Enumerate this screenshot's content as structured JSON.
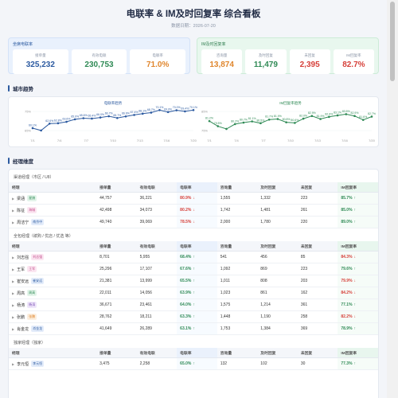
{
  "header": {
    "title": "电联率 & IM及时回复率 综合看板",
    "subtitle": "数据日期：2026-07-20"
  },
  "summary": {
    "call": {
      "title": "坐席电联率",
      "cards": [
        {
          "label": "接单量",
          "value": "325,232",
          "color": "#2c5aa0"
        },
        {
          "label": "有效电联",
          "value": "230,753",
          "color": "#2f8a55"
        },
        {
          "label": "电联率",
          "value": "71.0%",
          "color": "#e0862d"
        }
      ]
    },
    "im": {
      "title": "IM及时回复率",
      "cards": [
        {
          "label": "咨询量",
          "value": "13,874",
          "color": "#e0862d"
        },
        {
          "label": "及时回复",
          "value": "11,479",
          "color": "#2f8a55"
        },
        {
          "label": "未回复",
          "value": "2,395",
          "color": "#d6403a"
        },
        {
          "label": "IM回复率",
          "value": "82.7%",
          "color": "#d6403a"
        }
      ]
    }
  },
  "trend": {
    "section_title": "城市趋势",
    "call_chart": {
      "title": "电联率趋势",
      "color": "#2c5aa0",
      "y_labels": [
        "75%",
        "65%"
      ],
      "x_labels": [
        "7/1",
        "7/4",
        "7/7",
        "7/10",
        "7/13",
        "7/16",
        "7/20"
      ],
      "values": [
        60.1,
        58.8,
        62.6,
        62.8,
        63.6,
        65.0,
        65.6,
        65.4,
        66.0,
        66.7,
        65.7,
        66.6,
        67.4,
        68.1,
        68.7,
        70.1,
        69.0,
        70.0,
        69.4,
        70.1
      ],
      "point_labels": [
        "60.1%",
        "",
        "62.6%",
        "62.8%",
        "63.6%",
        "65.0%",
        "65.6%",
        "65.4%",
        "66.0%",
        "66.7%",
        "65.7%",
        "66.6%",
        "67.4%",
        "68.1%",
        "68.7%",
        "70.1%",
        "69.0%",
        "70.0%",
        "69.4%",
        "70.1%"
      ]
    },
    "im_chart": {
      "title": "IM回复率趋势",
      "color": "#2f8a55",
      "y_labels": [
        "85%",
        "75%"
      ],
      "x_labels": [
        "7/1",
        "7/4",
        "7/7",
        "7/10",
        "7/13",
        "7/16",
        "7/20"
      ],
      "values": [
        81.2,
        79.5,
        78.6,
        80.2,
        80.7,
        81.1,
        80.5,
        81.7,
        81.9,
        80.8,
        80.6,
        82.0,
        82.9,
        81.9,
        82.6,
        83.1,
        83.5,
        82.9,
        81.6,
        82.7
      ],
      "point_labels": [
        "81.2%",
        "79.5%",
        "",
        "80.2%",
        "80.7%",
        "81.1%",
        "80.5%",
        "81.7%",
        "81.9%",
        "80.8%",
        "80.6%",
        "82.0%",
        "82.9%",
        "81.9%",
        "82.6%",
        "83.1%",
        "83.5%",
        "82.9%",
        "81.6%",
        "82.7%"
      ]
    }
  },
  "detail": {
    "section_title": "经理维度",
    "columns": [
      "经理",
      "接单量",
      "有效电联",
      "电联率",
      "咨询量",
      "及时回复",
      "未回复",
      "IM回复率"
    ],
    "groups": [
      {
        "title": "渠道经理（市区 / U8）",
        "rows": [
          {
            "name": "梁涵",
            "tag": "星旗",
            "tag_color": "#2f8a55",
            "tag_bg": "#e3f4ea",
            "v1": "44,757",
            "v2": "36,221",
            "rate": "80.9%",
            "rate_arrow": "↓",
            "v3": "1,555",
            "v4": "1,332",
            "v5": "223",
            "im": "85.7%",
            "im_arrow": "↑"
          },
          {
            "name": "陈征",
            "tag": "海城",
            "tag_color": "#c24b8a",
            "tag_bg": "#fbe6f1",
            "v1": "42,498",
            "v2": "34,073",
            "rate": "80.2%",
            "rate_arrow": "↓",
            "v3": "1,742",
            "v4": "1,481",
            "v5": "261",
            "im": "85.0%",
            "im_arrow": "↑"
          },
          {
            "name": "周洁宁",
            "tag": "南京中",
            "tag_color": "#2c5aa0",
            "tag_bg": "#e3ecfa",
            "v1": "49,740",
            "v2": "39,069",
            "rate": "78.5%",
            "rate_arrow": "↓",
            "v3": "2,000",
            "v4": "1,780",
            "v5": "220",
            "im": "89.0%",
            "im_arrow": "↑"
          }
        ]
      },
      {
        "title": "全包经理（缤购 / 优店 / 优选 等）",
        "rows": [
          {
            "name": "刘志强",
            "tag": "刘志强",
            "tag_color": "#c24b8a",
            "tag_bg": "#fbe6f1",
            "v1": "8,701",
            "v2": "5,955",
            "rate": "68.4%",
            "rate_arrow": "↑",
            "v3": "541",
            "v4": "456",
            "v5": "85",
            "im": "84.3%",
            "im_arrow": "↓"
          },
          {
            "name": "王军",
            "tag": "王军",
            "tag_color": "#c24b8a",
            "tag_bg": "#fbe6f1",
            "v1": "25,296",
            "v2": "17,107",
            "rate": "67.6%",
            "rate_arrow": "↑",
            "v3": "1,092",
            "v4": "869",
            "v5": "223",
            "im": "79.6%",
            "im_arrow": "↑"
          },
          {
            "name": "崔安远",
            "tag": "崔安远",
            "tag_color": "#2c5aa0",
            "tag_bg": "#e3ecfa",
            "v1": "21,381",
            "v2": "13,999",
            "rate": "65.5%",
            "rate_arrow": "↑",
            "v3": "1,011",
            "v4": "808",
            "v5": "203",
            "im": "79.9%",
            "im_arrow": "↓"
          },
          {
            "name": "周高",
            "tag": "周高",
            "tag_color": "#2f8a55",
            "tag_bg": "#e3f4ea",
            "v1": "22,011",
            "v2": "14,056",
            "rate": "63.9%",
            "rate_arrow": "↑",
            "v3": "1,023",
            "v4": "861",
            "v5": "162",
            "im": "84.2%",
            "im_arrow": "↓"
          },
          {
            "name": "杨涛",
            "tag": "杨涛",
            "tag_color": "#7a4fb3",
            "tag_bg": "#efe6fa",
            "v1": "36,671",
            "v2": "23,461",
            "rate": "64.0%",
            "rate_arrow": "↑",
            "v3": "1,575",
            "v4": "1,214",
            "v5": "361",
            "im": "77.1%",
            "im_arrow": "↑"
          },
          {
            "name": "张鹏",
            "tag": "张鹏",
            "tag_color": "#e0862d",
            "tag_bg": "#fcefe0",
            "v1": "28,762",
            "v2": "18,211",
            "rate": "63.3%",
            "rate_arrow": "↑",
            "v3": "1,448",
            "v4": "1,190",
            "v5": "258",
            "im": "82.2%",
            "im_arrow": "↓"
          },
          {
            "name": "肖金龙",
            "tag": "肖金龙",
            "tag_color": "#2c5aa0",
            "tag_bg": "#e3ecfa",
            "v1": "41,649",
            "v2": "26,289",
            "rate": "63.1%",
            "rate_arrow": "↑",
            "v3": "1,753",
            "v4": "1,384",
            "v5": "369",
            "im": "78.9%",
            "im_arrow": "↑"
          }
        ]
      },
      {
        "title": "独家经理（独家）",
        "rows": [
          {
            "name": "李元恒",
            "tag": "李元恒",
            "tag_color": "#2c5aa0",
            "tag_bg": "#e3ecfa",
            "v1": "3,475",
            "v2": "2,258",
            "rate": "65.0%",
            "rate_arrow": "↑",
            "v3": "132",
            "v4": "102",
            "v5": "30",
            "im": "77.3%",
            "im_arrow": "↑"
          }
        ]
      }
    ]
  },
  "colors": {
    "up": "#2f8a55",
    "down": "#d6403a"
  }
}
